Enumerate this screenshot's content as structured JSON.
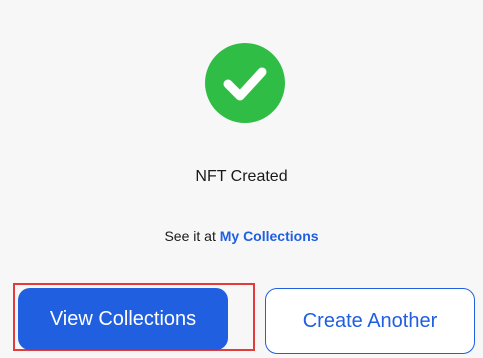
{
  "success": {
    "icon": "check-circle-icon",
    "color": "#2fbd46"
  },
  "title": "NFT Created",
  "subtitle": {
    "prefix": "See it at",
    "link_label": "My Collections"
  },
  "buttons": {
    "primary_label": "View Collections",
    "secondary_label": "Create Another"
  },
  "colors": {
    "primary": "#1f5fe0",
    "link": "#1f5fe0",
    "highlight": "#e23b3b",
    "background": "#f7f7f8"
  }
}
